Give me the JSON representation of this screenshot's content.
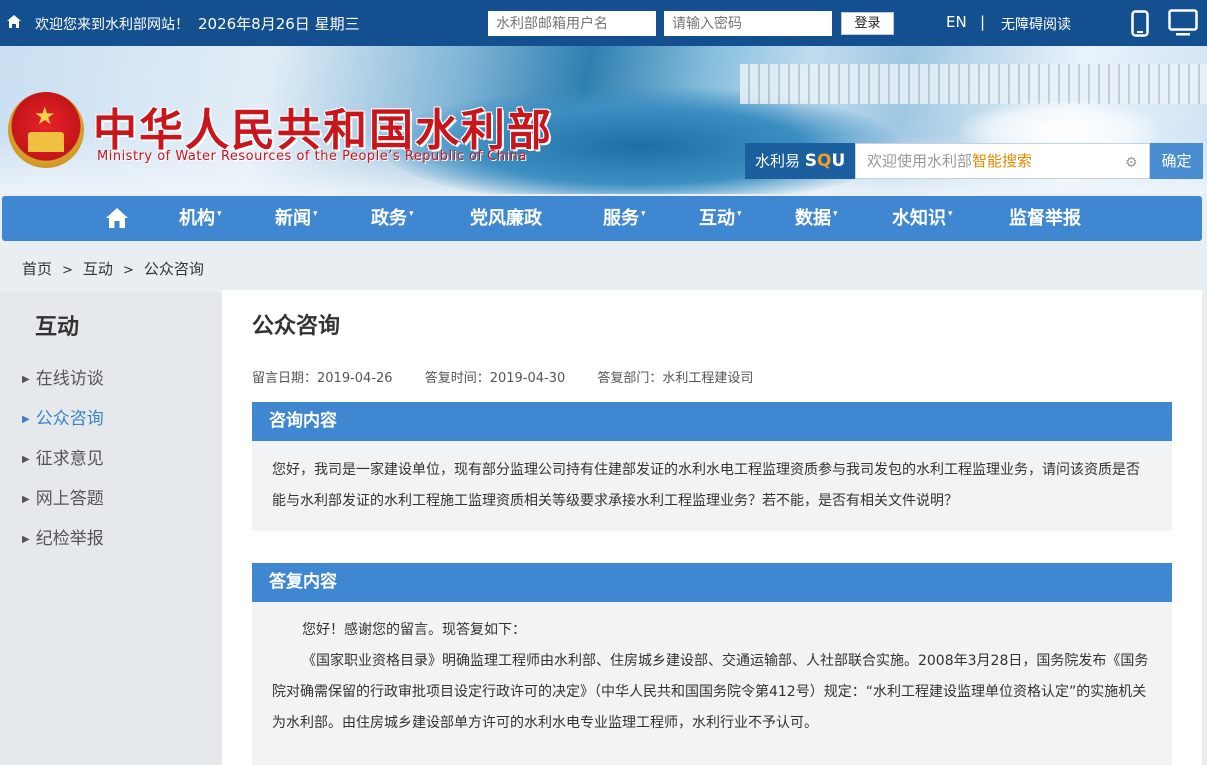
{
  "topbar": {
    "welcome": "欢迎您来到水利部网站！",
    "date": "2026年8月26日 星期三",
    "username_placeholder": "水利部邮箱用户名",
    "password_placeholder": "请输入密码",
    "login_label": "登录",
    "en_label": "EN",
    "separator": "|",
    "accessibility_label": "无障碍阅读",
    "icons": [
      "home-icon",
      "mobile-icon",
      "desktop-icon"
    ]
  },
  "banner": {
    "title_cn": "中华人民共和国水利部",
    "title_en": "Ministry of Water Resources of the People’s Republic of China",
    "emblem": "national-emblem"
  },
  "search": {
    "brand_prefix": "水利易",
    "brand_sou_1": "S",
    "brand_sou_2": "Q",
    "brand_sou_3": "U",
    "placeholder_prefix": "欢迎使用水利部",
    "placeholder_highlight": "智能搜索",
    "button_label": "确定",
    "highlight_color": "#e08a00"
  },
  "nav": {
    "items": [
      {
        "label": "机构",
        "dropdown": true
      },
      {
        "label": "新闻",
        "dropdown": true
      },
      {
        "label": "政务",
        "dropdown": true
      },
      {
        "label": "党风廉政",
        "dropdown": false
      },
      {
        "label": "服务",
        "dropdown": true
      },
      {
        "label": "互动",
        "dropdown": true
      },
      {
        "label": "数据",
        "dropdown": true
      },
      {
        "label": "水知识",
        "dropdown": true
      },
      {
        "label": "监督举报",
        "dropdown": false
      }
    ],
    "caret": "▾",
    "bg_color": "#3f87d0"
  },
  "breadcrumb": {
    "items": [
      "首页",
      "互动",
      "公众咨询"
    ],
    "separator": ">"
  },
  "sidebar": {
    "title": "互动",
    "items": [
      "在线访谈",
      "公众咨询",
      "征求意见",
      "网上答题",
      "纪检举报"
    ],
    "active_index": 1,
    "active_color": "#3a82c4"
  },
  "article": {
    "title": "公众咨询",
    "meta": {
      "message_date": "留言日期：2019-04-26",
      "reply_time": "答复时间：2019-04-30",
      "reply_dept": "答复部门：水利工程建设司"
    },
    "question": {
      "heading": "咨询内容",
      "text": "您好，我司是一家建设单位，现有部分监理公司持有住建部发证的水利水电工程监理资质参与我司发包的水利工程监理业务，请问该资质是否能与水利部发证的水利工程施工监理资质相关等级要求承接水利工程监理业务？若不能，是否有相关文件说明？"
    },
    "answer": {
      "heading": "答复内容",
      "paragraphs": [
        "您好！感谢您的留言。现答复如下：",
        "《国家职业资格目录》明确监理工程师由水利部、住房城乡建设部、交通运输部、人社部联合实施。2008年3月28日，国务院发布《国务院对确需保留的行政审批项目设定行政许可的决定》（中华人民共和国国务院令第412号）规定：“水利工程建设监理单位资格认定”的实施机关为水利部。由住房城乡建设部单方许可的水利水电专业监理工程师，水利行业不予认可。"
      ]
    }
  }
}
